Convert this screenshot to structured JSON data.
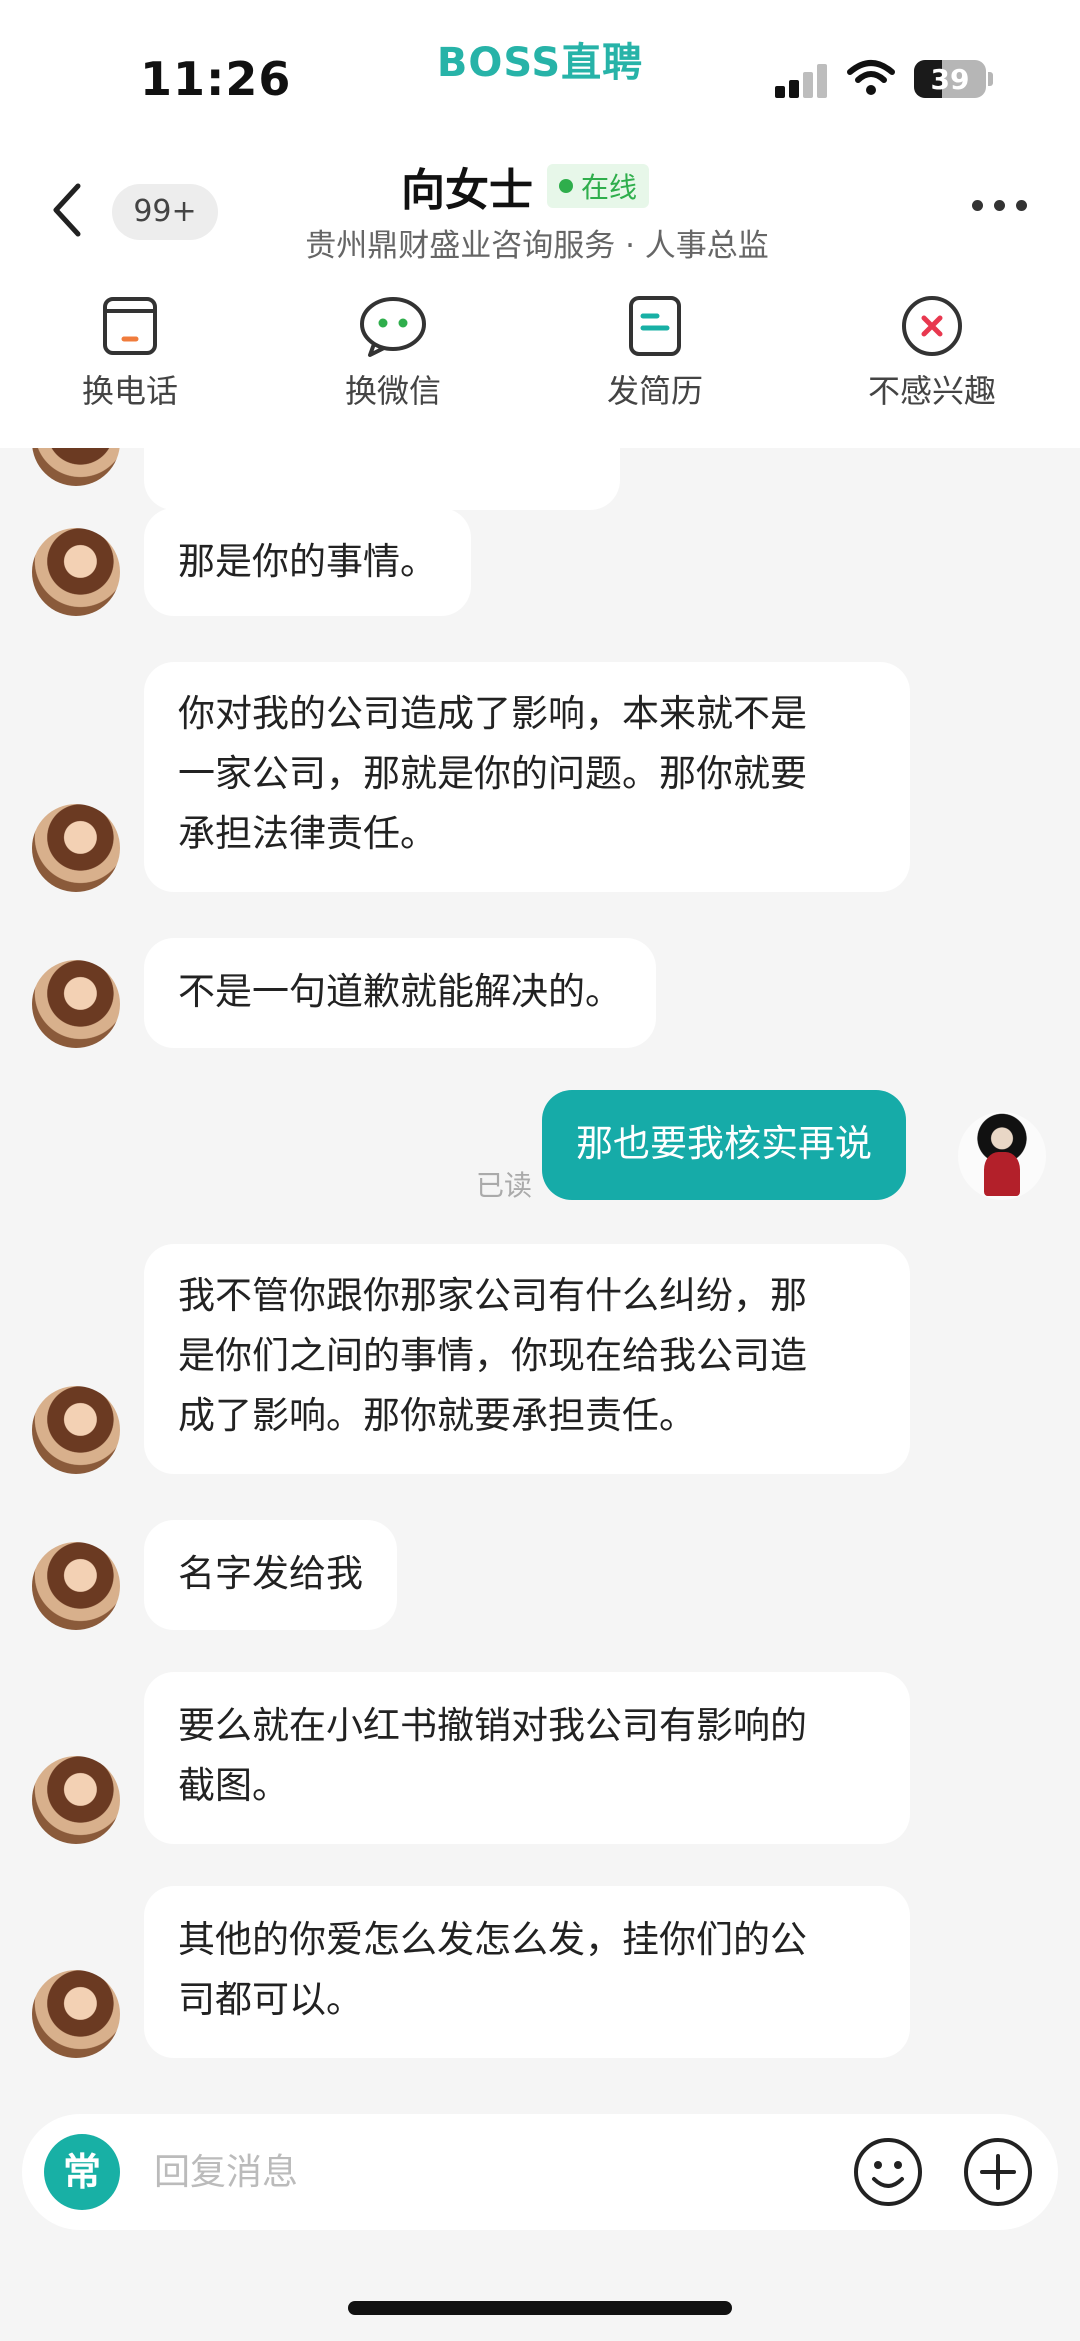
{
  "status_bar": {
    "time": "11:26",
    "carrier_title": "BOSS直聘",
    "battery": "39",
    "battery_level": 0.39
  },
  "header": {
    "unread_badge": "99+",
    "contact_name": "向女士",
    "online_status": "在线",
    "subtitle": "贵州鼎财盛业咨询服务 · 人事总监"
  },
  "actions": [
    {
      "label": "换电话",
      "icon": "phone-card-icon"
    },
    {
      "label": "换微信",
      "icon": "wechat-icon"
    },
    {
      "label": "发简历",
      "icon": "resume-icon"
    },
    {
      "label": "不感兴趣",
      "icon": "close-circle-icon"
    }
  ],
  "messages": [
    {
      "from": "contact",
      "text": "那是你的事情。"
    },
    {
      "from": "contact",
      "text": "你对我的公司造成了影响，本来就不是\n一家公司，那就是你的问题。那你就要\n承担法律责任。"
    },
    {
      "from": "contact",
      "text": "不是一句道歉就能解决的。"
    },
    {
      "from": "me",
      "text": "那也要我核实再说",
      "read_status": "已读"
    },
    {
      "from": "contact",
      "text": "我不管你跟你那家公司有什么纠纷，那\n是你们之间的事情，你现在给我公司造\n成了影响。那你就要承担责任。"
    },
    {
      "from": "contact",
      "text": "名字发给我"
    },
    {
      "from": "contact",
      "text": "要么就在小红书撤销对我公司有影响的\n截图。"
    },
    {
      "from": "contact",
      "text": "其他的你爱怎么发怎么发，挂你们的公\n司都可以。"
    }
  ],
  "input": {
    "common_phrases_label": "常",
    "placeholder": "回复消息"
  },
  "colors": {
    "accent": "#16aba8",
    "online": "#2fae4c",
    "background": "#f5f5f5"
  }
}
